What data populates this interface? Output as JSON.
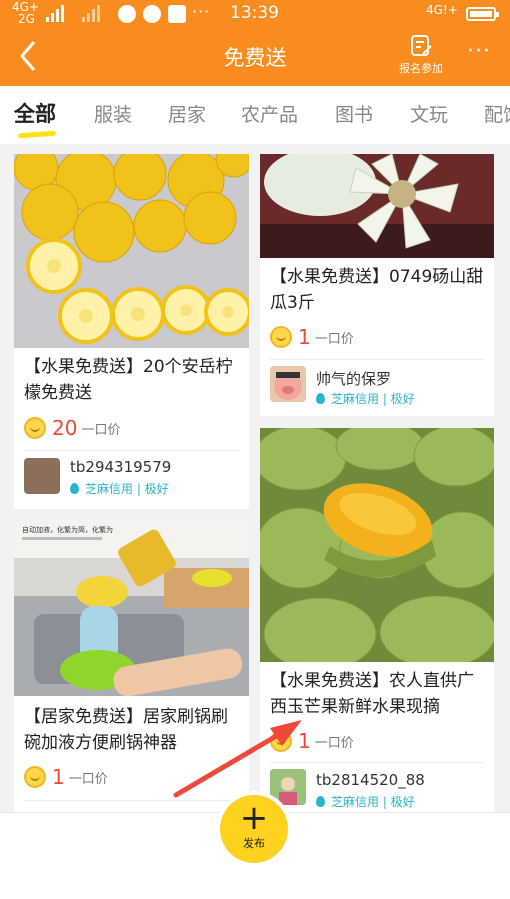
{
  "status_bar": {
    "network_top": "4G+",
    "network_bottom": "2G",
    "dots": "···",
    "time": "13:39",
    "right_network": "4G!+"
  },
  "header": {
    "title": "免费送",
    "signup_label": "报名参加",
    "more": "···"
  },
  "tabs": [
    "全部",
    "服装",
    "居家",
    "农产品",
    "图书",
    "文玩",
    "配饰"
  ],
  "active_tab_index": 0,
  "cards": {
    "lemon": {
      "title": "【水果免费送】20个安岳柠檬免费送",
      "price": "20",
      "price_label": "一口价",
      "seller": "tb294319579",
      "credit": "芝麻信用 | 极好"
    },
    "melon": {
      "title": "【水果免费送】0749砀山甜瓜3斤",
      "price": "1",
      "price_label": "一口价",
      "seller": "帅气的保罗",
      "credit": "芝麻信用 | 极好"
    },
    "mango": {
      "title": "【水果免费送】农人直供广西玉芒果新鲜水果现摘",
      "price": "1",
      "price_label": "一口价",
      "seller": "tb2814520_88",
      "credit": "芝麻信用 | 极好"
    },
    "brush": {
      "title": "【居家免费送】居家刷锅刷碗加液方便刷锅神器",
      "price": "1",
      "price_label": "一口价",
      "image_text": "自动加液，化繁为简，化繁为"
    }
  },
  "bottom": {
    "publish_label": "发布"
  },
  "colors": {
    "brand_orange": "#f98c1f",
    "price_red": "#f0483a",
    "credit_teal": "#29b5cc",
    "publish_yellow": "#ffd21f",
    "annotation_arrow": "#f0483a"
  }
}
